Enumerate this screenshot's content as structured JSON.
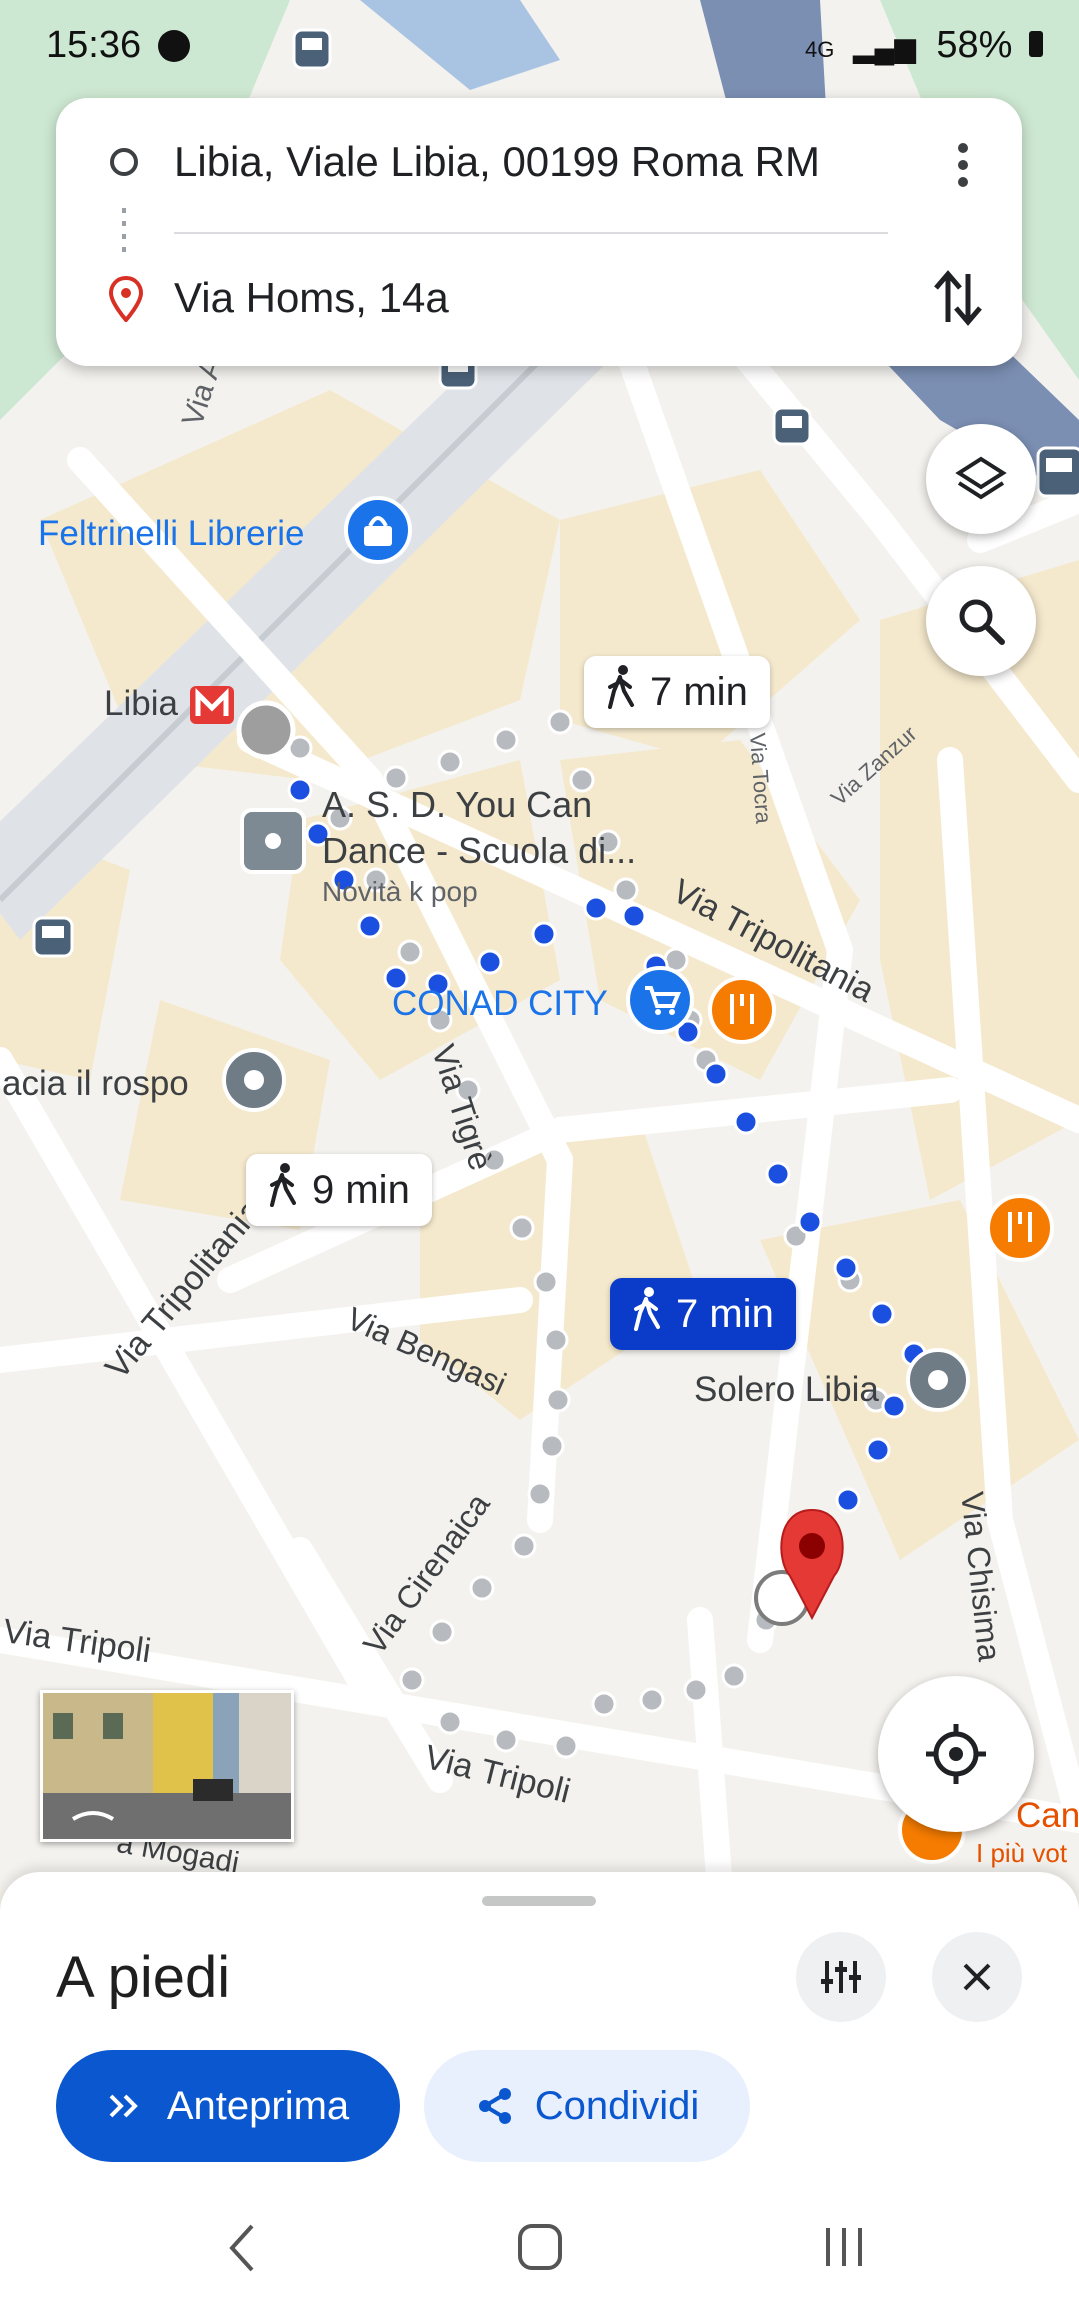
{
  "status_bar": {
    "time": "15:36",
    "network": "4G",
    "battery": "58%"
  },
  "directions": {
    "origin": "Libia, Viale Libia, 00199 Roma RM",
    "destination": "Via Homs, 14a"
  },
  "map": {
    "streets": [
      "Via Am",
      "Via Tripolitania",
      "Via Tigrè",
      "Via Bengasi",
      "Via Cirenaica",
      "Via Tripoli",
      "Via Tripoli",
      "Via Chisima",
      "Via Zanzur",
      "Via Tocra",
      "Via Tripolitania",
      "a Mogadi"
    ],
    "places": {
      "feltrinelli": "Feltrinelli Librerie",
      "libia": "Libia",
      "dance_line1": "A. S. D. You Can",
      "dance_line2": "Dance - Scuola di...",
      "dance_sub": "Novità k pop",
      "conad": "CONAD CITY",
      "rospo": "acia il rospo",
      "solero": "Solero Libia",
      "car_partial": "Can",
      "car_partial_sub": "I più vot"
    },
    "route_chips": [
      {
        "label": "7 min",
        "selected": false
      },
      {
        "label": "9 min",
        "selected": false
      },
      {
        "label": "7 min",
        "selected": true
      }
    ],
    "colors": {
      "route_selected": "#1a4fe0",
      "route_alt": "#b9bcc2",
      "destination_pin": "#e53935",
      "chip_selected": "#0b3cc9"
    }
  },
  "sheet": {
    "title": "A piedi",
    "preview_label": "Anteprima",
    "share_label": "Condividi"
  },
  "icons": [
    "more-vert-icon",
    "swap-icon",
    "layers-icon",
    "search-icon",
    "my-location-icon",
    "tune-icon",
    "close-icon",
    "share-icon",
    "walk-icon",
    "bus-icon",
    "metro-icon",
    "shopping-icon",
    "restaurant-icon"
  ]
}
